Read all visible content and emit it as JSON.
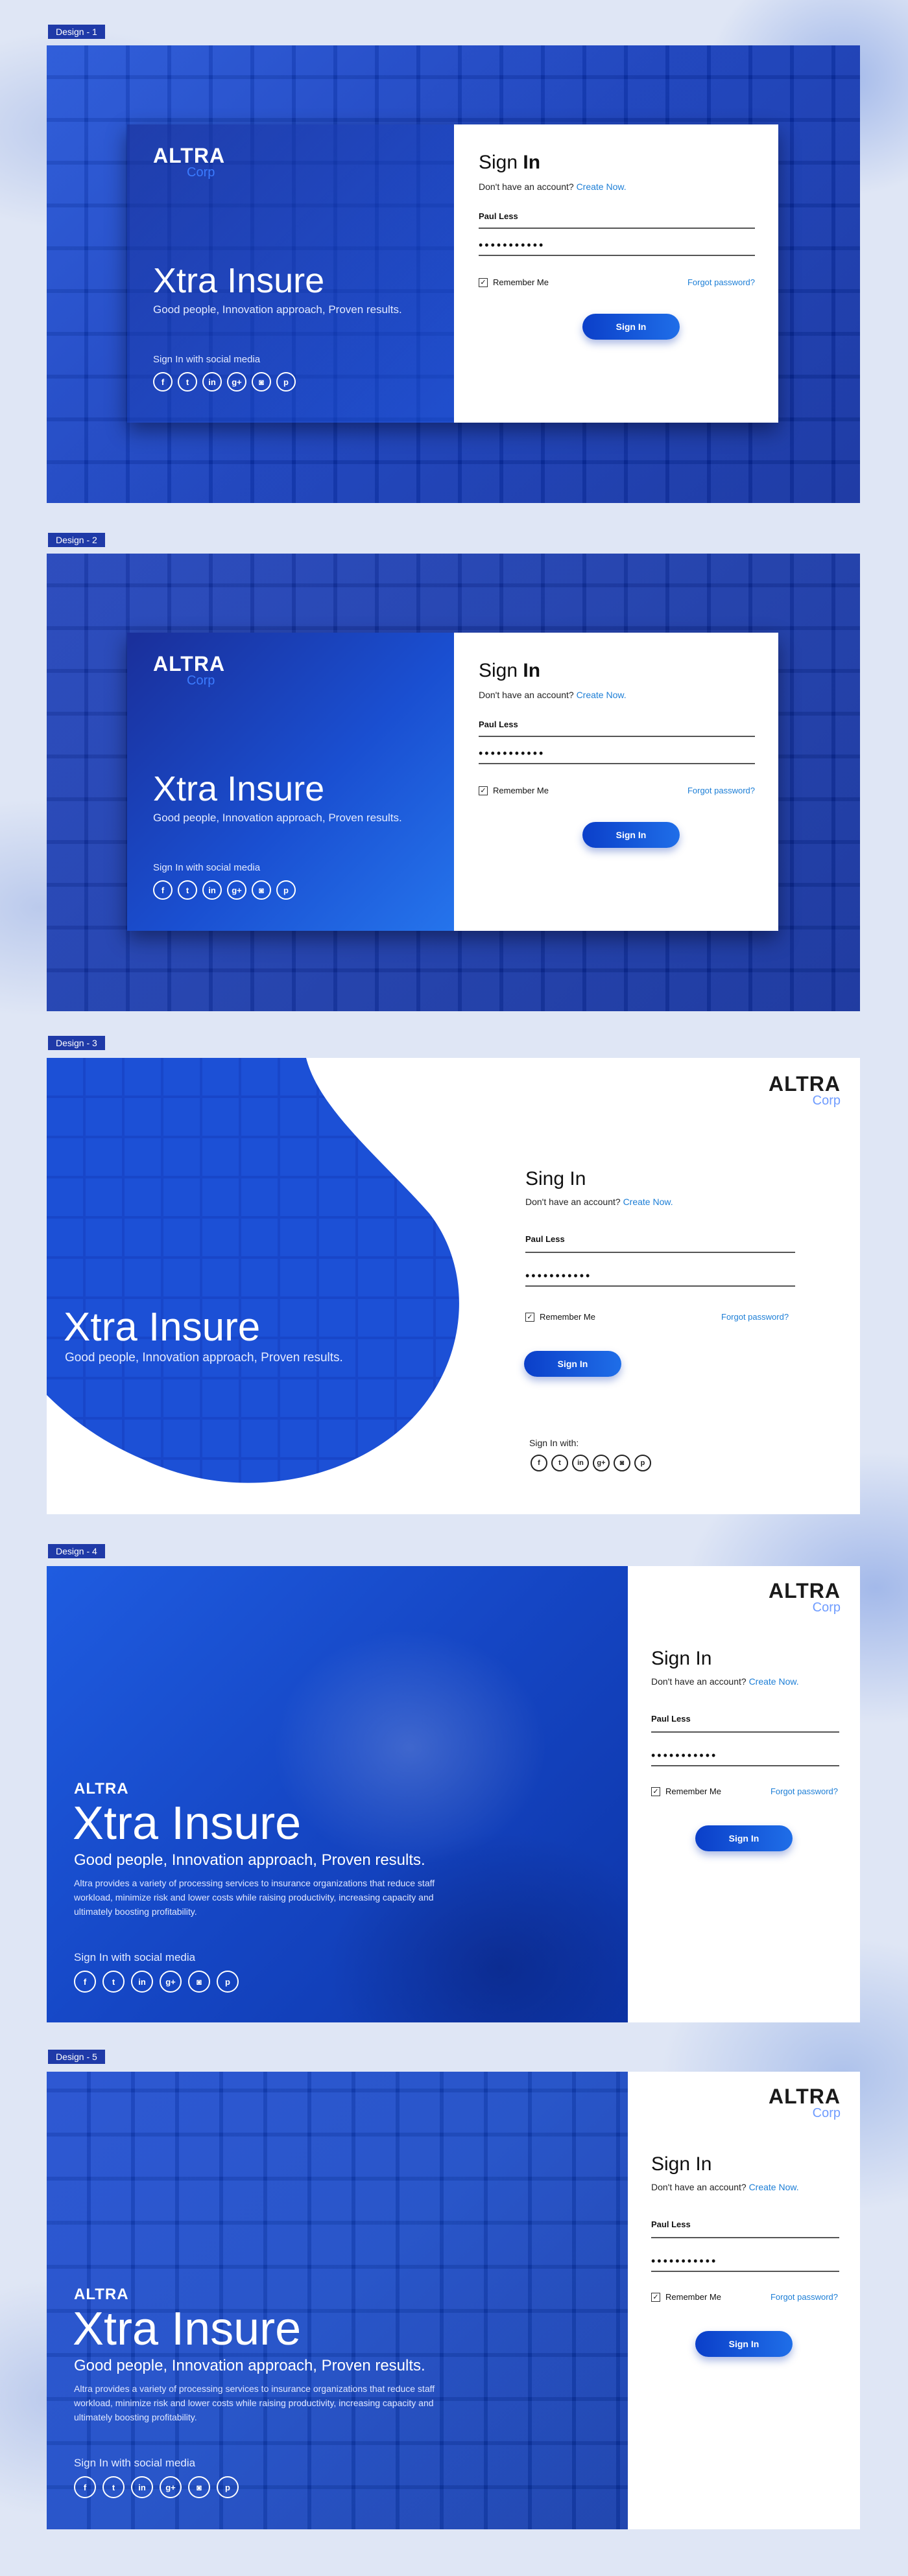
{
  "designs": [
    {
      "tag": "Design - 1",
      "logo": {
        "main": "ALTRA",
        "sub": "Corp"
      },
      "brand": {
        "light": "Xtra",
        "bold": "Insure"
      },
      "tagline": "Good people, Innovation approach, Proven results.",
      "social_label": "Sign In with social media",
      "signin": {
        "title_light": "Sign ",
        "title_bold": "In",
        "no_account": "Don't have an account? ",
        "create_link": "Create Now.",
        "username": "Paul Less",
        "password": "•••••••••••",
        "remember": "Remember Me",
        "forgot": "Forgot password?",
        "button": "Sign In"
      }
    },
    {
      "tag": "Design - 2",
      "logo": {
        "main": "ALTRA",
        "sub": "Corp"
      },
      "brand": {
        "light": "Xtra",
        "bold": "Insure"
      },
      "tagline": "Good people, Innovation approach, Proven results.",
      "social_label": "Sign In with social media",
      "signin": {
        "title_light": "Sign ",
        "title_bold": "In",
        "no_account": "Don't have an account? ",
        "create_link": "Create Now.",
        "username": "Paul Less",
        "password": "•••••••••••",
        "remember": "Remember Me",
        "forgot": "Forgot password?",
        "button": "Sign In"
      }
    },
    {
      "tag": "Design - 3",
      "logo": {
        "main": "ALTRA",
        "sub": "Corp"
      },
      "brand": {
        "light": "Xtra",
        "bold": "Insure"
      },
      "tagline": "Good people, Innovation approach, Proven results.",
      "social_label": "Sign In with:",
      "signin": {
        "title_light": "Sing In",
        "no_account": "Don't have an account? ",
        "create_link": "Create Now.",
        "username": "Paul Less",
        "password": "•••••••••••",
        "remember": "Remember Me",
        "forgot": "Forgot password?",
        "button": "Sign In"
      }
    },
    {
      "tag": "Design - 4",
      "logo": {
        "main": "ALTRA",
        "sub": "Corp"
      },
      "left_logo": "ALTRA",
      "brand": {
        "light": "Xtra",
        "bold": "Insure"
      },
      "tagline": "Good people, Innovation approach, Proven results.",
      "description": "Altra provides a variety of processing services to insurance organizations that reduce staff workload, minimize risk and lower costs while raising productivity, increasing capacity and ultimately boosting profitability.",
      "social_label": "Sign In with social media",
      "signin": {
        "title_light": "Sign In",
        "no_account": "Don't have an account? ",
        "create_link": "Create Now.",
        "username": "Paul Less",
        "password": "•••••••••••",
        "remember": "Remember Me",
        "forgot": "Forgot password?",
        "button": "Sign In"
      }
    },
    {
      "tag": "Design - 5",
      "logo": {
        "main": "ALTRA",
        "sub": "Corp"
      },
      "left_logo": "ALTRA",
      "brand": {
        "light": "Xtra",
        "bold": "Insure"
      },
      "tagline": "Good people, Innovation approach, Proven results.",
      "description": "Altra provides a variety of processing services to insurance organizations that reduce staff workload, minimize risk and lower costs while raising productivity, increasing capacity and ultimately boosting profitability.",
      "social_label": "Sign In with social media",
      "signin": {
        "title_light": "Sign In",
        "no_account": "Don't have an account? ",
        "create_link": "Create Now.",
        "username": "Paul Less",
        "password": "•••••••••••",
        "remember": "Remember Me",
        "forgot": "Forgot password?",
        "button": "Sign In"
      }
    }
  ],
  "social_icons": [
    "facebook-icon",
    "twitter-icon",
    "linkedin-icon",
    "google-plus-icon",
    "instagram-icon",
    "pinterest-icon"
  ],
  "social_glyphs": [
    "f",
    "t",
    "in",
    "g+",
    "◙",
    "p"
  ],
  "colors": {
    "accent": "#1c7ed6",
    "brand_blue": "#0e36b8",
    "logo_sub": "#3b7bff"
  }
}
